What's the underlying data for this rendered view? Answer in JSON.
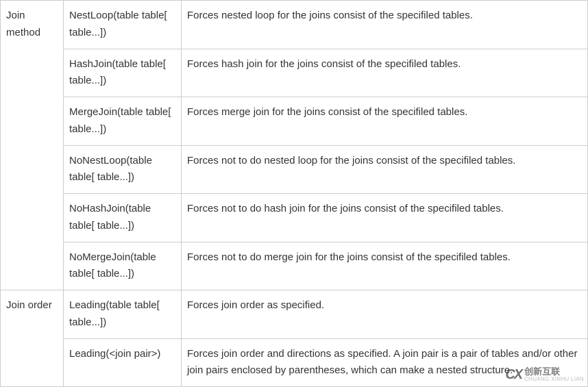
{
  "categories": [
    {
      "name": "Join method",
      "rowspan": 6
    },
    {
      "name": "Join order",
      "rowspan": 2
    }
  ],
  "rows": [
    {
      "cat": 0,
      "hint": "NestLoop(table table[ table...])",
      "desc": "Forces nested loop for the joins consist of the specifiled tables."
    },
    {
      "cat": 0,
      "hint": "HashJoin(table table[ table...])",
      "desc": "Forces hash join for the joins consist of the specifiled tables."
    },
    {
      "cat": 0,
      "hint": "MergeJoin(table table[ table...])",
      "desc": "Forces merge join for the joins consist of the specifiled tables."
    },
    {
      "cat": 0,
      "hint": "NoNestLoop(table table[ table...])",
      "desc": "Forces not to do nested loop for the joins consist of the specifiled tables."
    },
    {
      "cat": 0,
      "hint": "NoHashJoin(table table[ table...])",
      "desc": "Forces not to do hash join for the joins consist of the specifiled tables."
    },
    {
      "cat": 0,
      "hint": "NoMergeJoin(table table[ table...])",
      "desc": "Forces not to do merge join for the joins consist of the specifiled tables."
    },
    {
      "cat": 1,
      "hint": "Leading(table table[ table...])",
      "desc": "Forces join order as specified."
    },
    {
      "cat": 1,
      "hint": "Leading(<join pair>)",
      "desc": "Forces join order and directions as specified. A join pair is a pair of tables and/or other join pairs enclosed by parentheses, which can make a nested structure."
    }
  ],
  "watermark": {
    "logo": "CX",
    "brand": "创新互联",
    "url": "CHUANG XINHU LIAN"
  }
}
